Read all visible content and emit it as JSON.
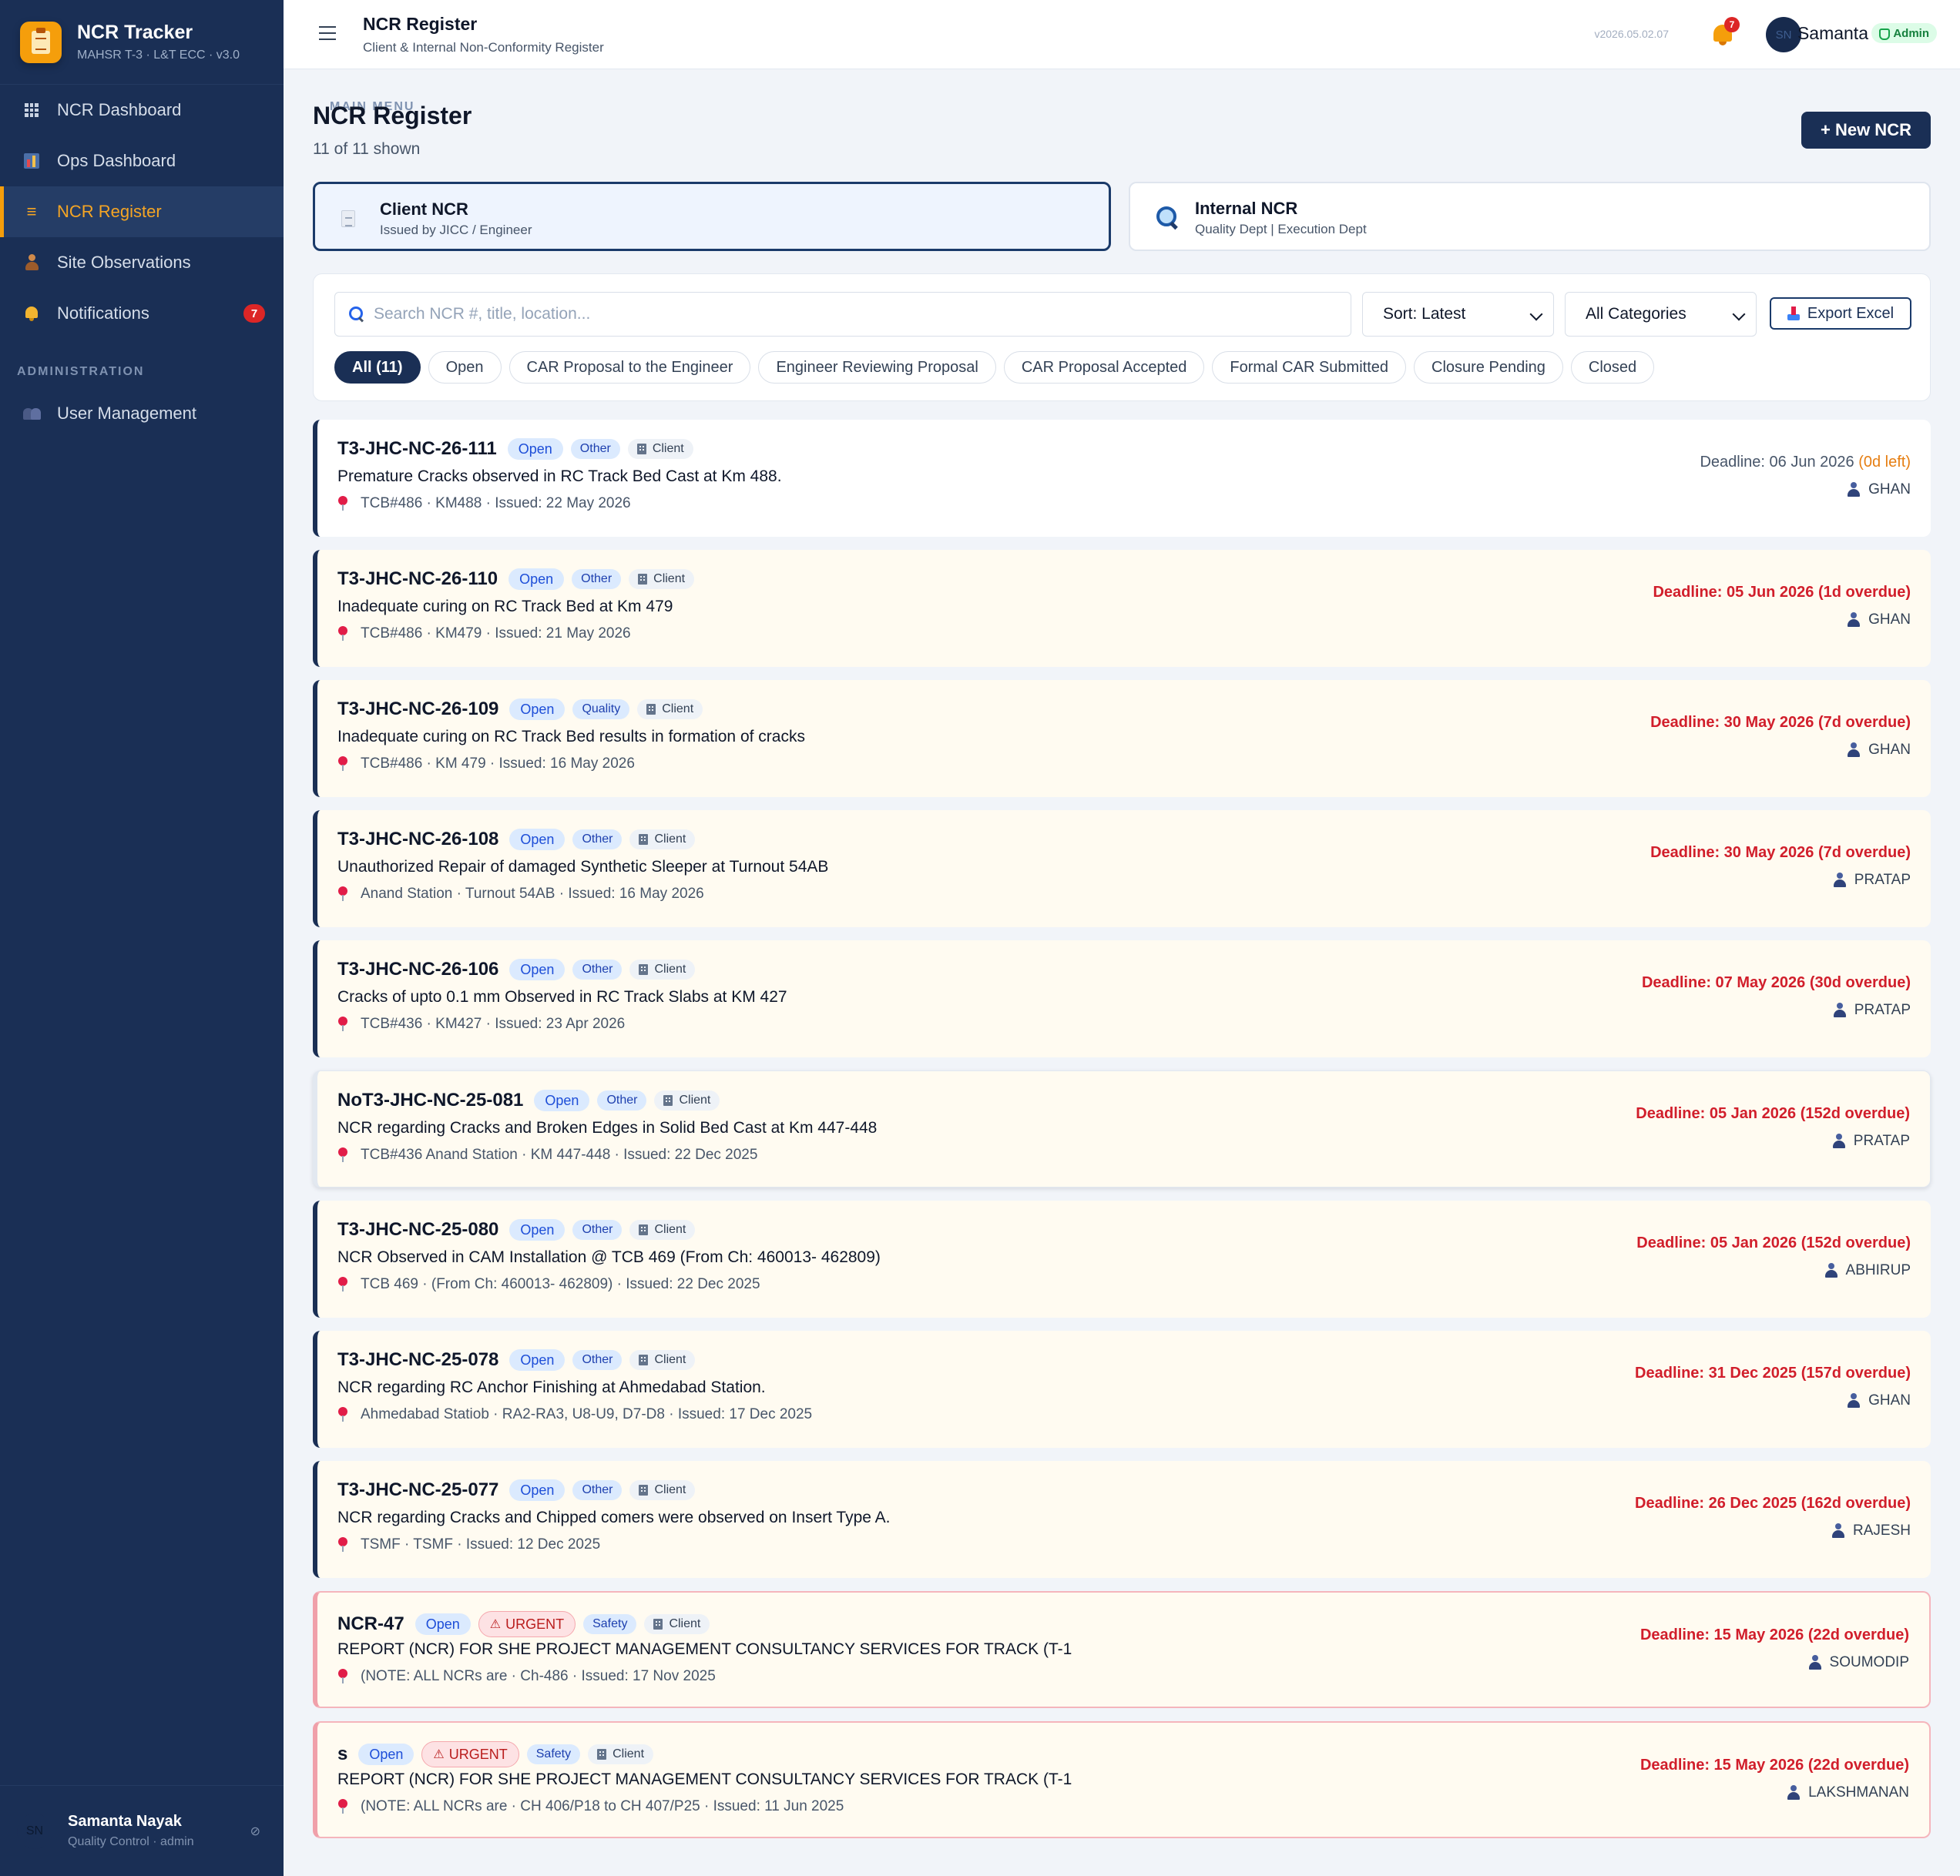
{
  "sidebar": {
    "brand_title": "NCR Tracker",
    "brand_sub": "MAHSR T-3 · L&T ECC · v3.0",
    "main_menu_label": "MAIN MENU",
    "admin_label": "ADMINISTRATION",
    "items": [
      {
        "label": "NCR Dashboard",
        "icon": "grid-icon"
      },
      {
        "label": "Ops Dashboard",
        "icon": "bar-chart-icon"
      },
      {
        "label": "NCR Register",
        "icon": "list-icon",
        "active": true
      },
      {
        "label": "Site Observations",
        "icon": "person-icon"
      },
      {
        "label": "Notifications",
        "icon": "bell-icon",
        "badge": "7"
      }
    ],
    "admin_items": [
      {
        "label": "User Management",
        "icon": "users-icon"
      }
    ],
    "user": {
      "initials": "SN",
      "name": "Samanta Nayak",
      "role": "Quality Control · admin"
    }
  },
  "topbar": {
    "title": "NCR Register",
    "subtitle": "Client & Internal Non-Conformity Register",
    "version": "v2026.05.02.07",
    "notif_count": "7",
    "avatar_initials": "SN",
    "user_name": "Samanta",
    "role_badge": "Admin"
  },
  "page": {
    "title": "NCR Register",
    "count": "11 of 11 shown",
    "new_button": "+ New NCR"
  },
  "types": {
    "client": {
      "title": "Client NCR",
      "sub": "Issued by JICC / Engineer"
    },
    "internal": {
      "title": "Internal NCR",
      "sub": "Quality Dept | Execution Dept"
    }
  },
  "filters": {
    "search_placeholder": "Search NCR #, title, location...",
    "sort": "Sort: Latest",
    "category": "All Categories",
    "export": "Export Excel",
    "chips": [
      "All (11)",
      "Open",
      "CAR Proposal to the Engineer",
      "Engineer Reviewing Proposal",
      "CAR Proposal Accepted",
      "Formal CAR Submitted",
      "Closure Pending",
      "Closed"
    ]
  },
  "ncrs": [
    {
      "id": "T3-JHC-NC-26-111",
      "status": "Open",
      "category": "Other",
      "source": "Client",
      "title": "Premature Cracks observed in RC Track Bed Cast at Km 488.",
      "meta": "TCB#486 · KM488 · Issued: 22 May 2026",
      "deadline": "Deadline: 06 Jun 2026",
      "deadline_note": "(0d left)",
      "assignee": "GHAN"
    },
    {
      "id": "T3-JHC-NC-26-110",
      "status": "Open",
      "category": "Other",
      "source": "Client",
      "title": "Inadequate curing on RC Track Bed at Km 479",
      "meta": "TCB#486 · KM479 · Issued: 21 May 2026",
      "deadline": "Deadline: 05 Jun 2026 (1d overdue)",
      "assignee": "GHAN"
    },
    {
      "id": "T3-JHC-NC-26-109",
      "status": "Open",
      "category": "Quality",
      "source": "Client",
      "title": "Inadequate curing on RC Track Bed results in formation of cracks",
      "meta": "TCB#486 · KM 479 · Issued: 16 May 2026",
      "deadline": "Deadline: 30 May 2026 (7d overdue)",
      "assignee": "GHAN"
    },
    {
      "id": "T3-JHC-NC-26-108",
      "status": "Open",
      "category": "Other",
      "source": "Client",
      "title": "Unauthorized Repair of damaged Synthetic Sleeper at Turnout 54AB",
      "meta": "Anand Station · Turnout 54AB · Issued: 16 May 2026",
      "deadline": "Deadline: 30 May 2026 (7d overdue)",
      "assignee": "PRATAP"
    },
    {
      "id": "T3-JHC-NC-26-106",
      "status": "Open",
      "category": "Other",
      "source": "Client",
      "title": "Cracks of upto 0.1 mm Observed in RC Track Slabs at KM 427",
      "meta": "TCB#436 · KM427 · Issued: 23 Apr 2026",
      "deadline": "Deadline: 07 May 2026 (30d overdue)",
      "assignee": "PRATAP"
    },
    {
      "id": "NoT3-JHC-NC-25-081",
      "status": "Open",
      "category": "Other",
      "source": "Client",
      "title": "NCR regarding Cracks and Broken Edges in Solid Bed Cast at Km 447-448",
      "meta": "TCB#436 Anand Station · KM 447-448 · Issued: 22 Dec 2025",
      "deadline": "Deadline: 05 Jan 2026 (152d overdue)",
      "assignee": "PRATAP"
    },
    {
      "id": "T3-JHC-NC-25-080",
      "status": "Open",
      "category": "Other",
      "source": "Client",
      "title": "NCR Observed in CAM Installation @ TCB 469 (From Ch: 460013- 462809)",
      "meta": "TCB 469 · (From Ch: 460013- 462809) · Issued: 22 Dec 2025",
      "deadline": "Deadline: 05 Jan 2026 (152d overdue)",
      "assignee": "ABHIRUP"
    },
    {
      "id": "T3-JHC-NC-25-078",
      "status": "Open",
      "category": "Other",
      "source": "Client",
      "title": "NCR regarding RC Anchor Finishing at Ahmedabad Station.",
      "meta": "Ahmedabad Statiob · RA2-RA3, U8-U9, D7-D8 · Issued: 17 Dec 2025",
      "deadline": "Deadline: 31 Dec 2025 (157d overdue)",
      "assignee": "GHAN"
    },
    {
      "id": "T3-JHC-NC-25-077",
      "status": "Open",
      "category": "Other",
      "source": "Client",
      "title": "NCR regarding Cracks and Chipped comers were observed on Insert Type A.",
      "meta": "TSMF · TSMF · Issued: 12 Dec 2025",
      "deadline": "Deadline: 26 Dec 2025 (162d overdue)",
      "assignee": "RAJESH"
    },
    {
      "id": "NCR-47",
      "status": "Open",
      "urgent": "URGENT",
      "category": "Safety",
      "source": "Client",
      "title": "REPORT (NCR) FOR SHE PROJECT MANAGEMENT CONSULTANCY SERVICES FOR TRACK (T-1",
      "meta": "(NOTE: ALL NCRs are · Ch-486 · Issued: 17 Nov 2025",
      "deadline": "Deadline: 15 May 2026 (22d overdue)",
      "assignee": "SOUMODIP"
    },
    {
      "id": "s",
      "status": "Open",
      "urgent": "URGENT",
      "category": "Safety",
      "source": "Client",
      "title": "REPORT (NCR) FOR SHE PROJECT MANAGEMENT CONSULTANCY SERVICES FOR TRACK (T-1",
      "meta": "(NOTE: ALL NCRs are · CH 406/P18 to CH 407/P25 · Issued: 11 Jun 2025",
      "deadline": "Deadline: 15 May 2026 (22d overdue)",
      "assignee": "LAKSHMANAN"
    }
  ],
  "colors": {
    "sidebar_bg": "#1a2f55",
    "accent": "#f59e0b",
    "overdue": "#d11e2b",
    "open_badge": "#dbeafe",
    "urgent_badge": "#fde2e4"
  }
}
